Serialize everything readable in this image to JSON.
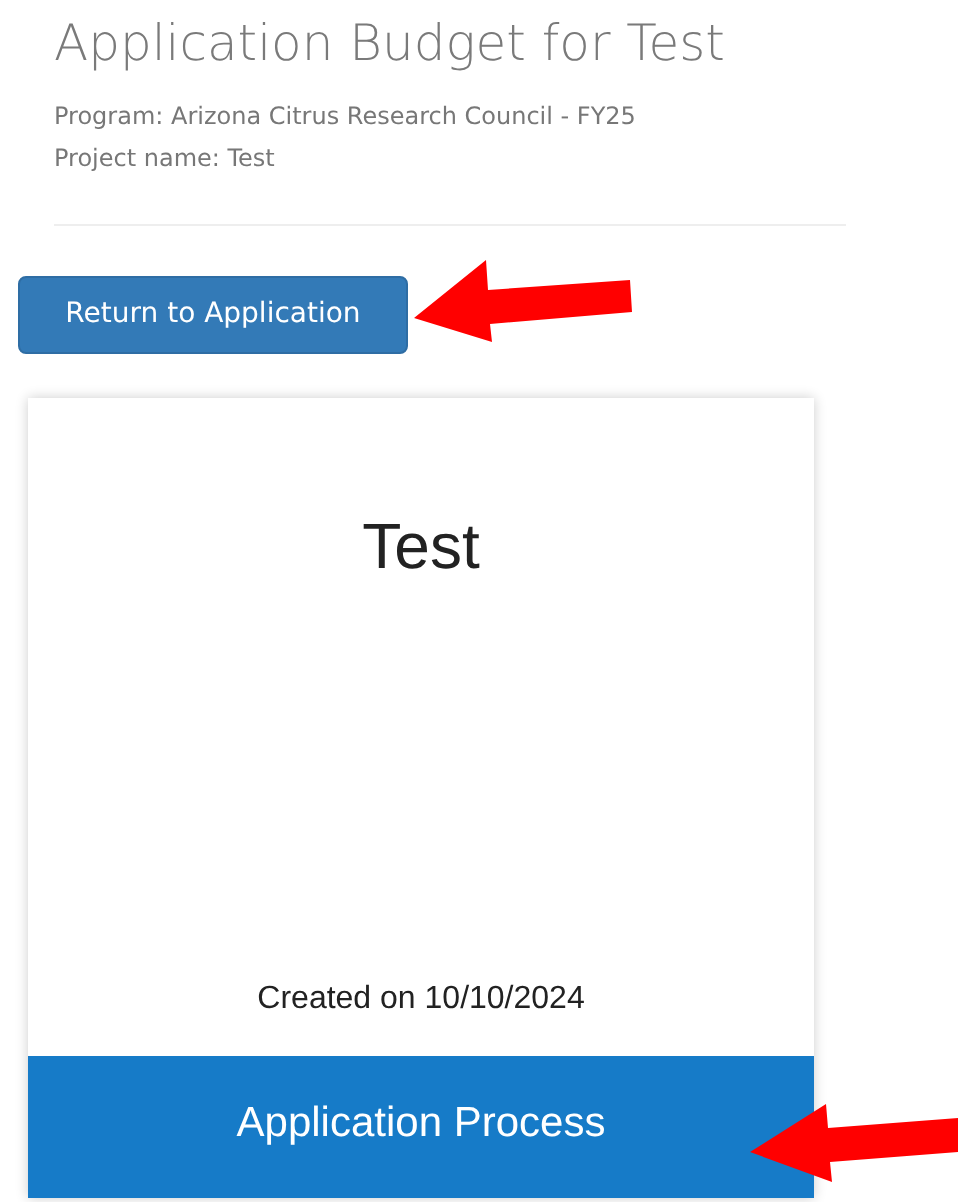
{
  "header": {
    "title": "Application Budget for Test",
    "program": "Program: Arizona Citrus Research Council - FY25",
    "project_name": "Project name: Test"
  },
  "return_button": {
    "label": "Return to Application"
  },
  "card": {
    "title": "Test",
    "created": "Created on 10/10/2024",
    "action": "Application Process"
  }
}
